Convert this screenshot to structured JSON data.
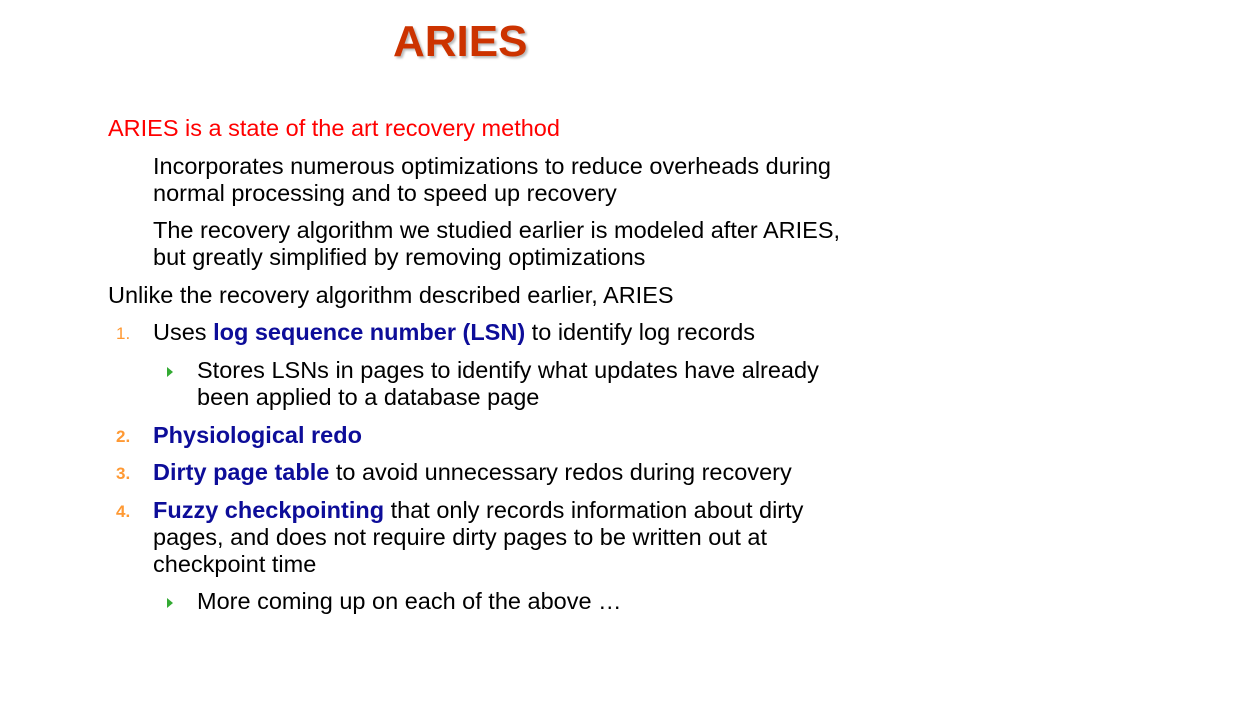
{
  "slide": {
    "title": "ARIES",
    "bullet1": "ARIES is a state of the art recovery method",
    "sub1_line1": "Incorporates numerous optimizations to reduce overheads during",
    "sub1_line2": "normal processing and to speed up recovery",
    "sub2_line1": "The recovery algorithm we studied earlier is modeled after ARIES,",
    "sub2_line2": "but greatly simplified by removing optimizations",
    "bullet2": "Unlike the recovery algorithm described earlier, ARIES",
    "items": [
      {
        "num": "1.",
        "prefix": "Uses ",
        "bold": "log sequence number (LSN)",
        "rest": " to identify log records"
      },
      {
        "num": "2.",
        "bold": "Physiological redo"
      },
      {
        "num": "3.",
        "bold": "Dirty page table",
        "rest": " to avoid unnecessary redos during recovery"
      },
      {
        "num": "4.",
        "bold": "Fuzzy checkpointing",
        "rest": " that only records information about dirty",
        "line2": "pages, and does not require dirty pages to be written out at",
        "line3": "checkpoint time"
      }
    ],
    "sub_item1_line1": "Stores LSNs in pages to identify what updates have already",
    "sub_item1_line2": "been applied to a database page",
    "sub_item4": "More coming up on each of the above …"
  },
  "colors": {
    "title": "#cc3300",
    "highlight_text": "#ff0000",
    "keyword": "#0d0d99",
    "number": "#ff9933",
    "arrow": "#33aa33"
  }
}
